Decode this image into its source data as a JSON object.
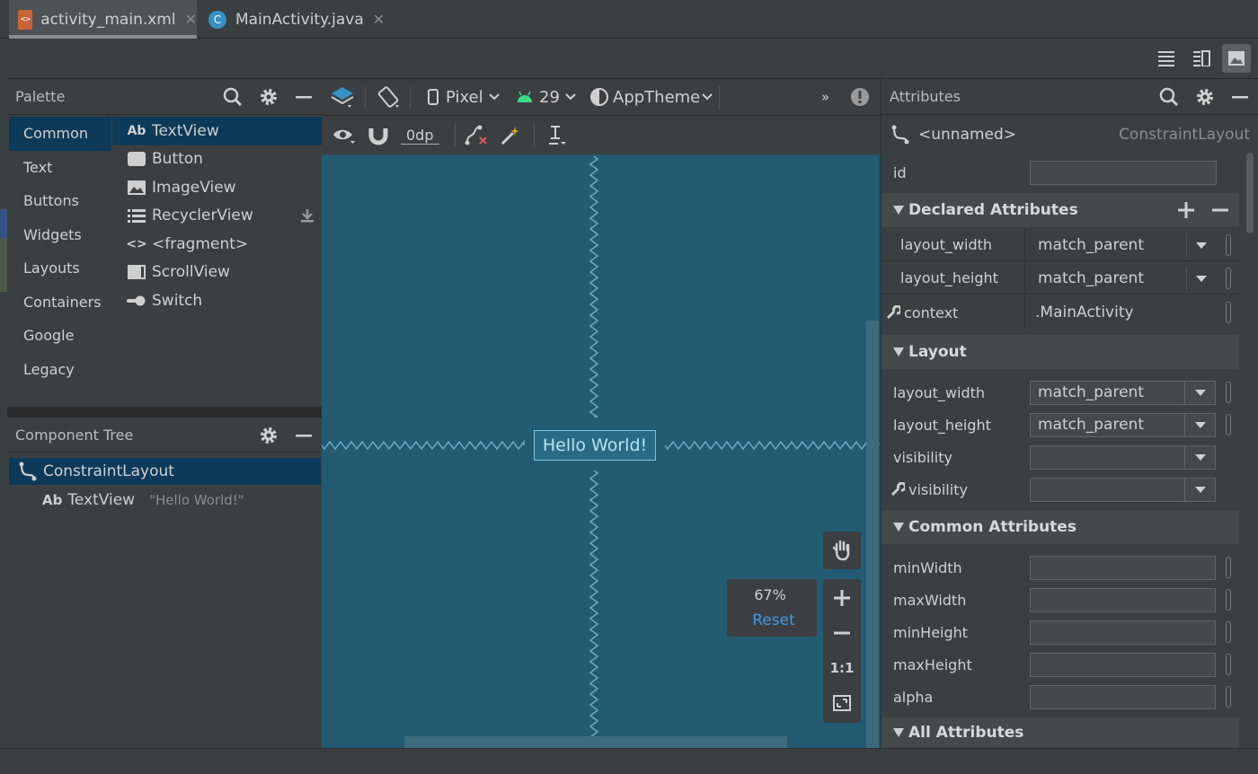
{
  "tabs": [
    {
      "label": "activity_main.xml",
      "close": "✕"
    },
    {
      "label": "MainActivity.java",
      "icon_letter": "C",
      "close": "✕"
    }
  ],
  "palette": {
    "title": "Palette",
    "categories": [
      "Common",
      "Text",
      "Buttons",
      "Widgets",
      "Layouts",
      "Containers",
      "Google",
      "Legacy"
    ],
    "widgets": [
      {
        "label": "TextView",
        "icon": "Ab"
      },
      {
        "label": "Button",
        "icon": "button-icon"
      },
      {
        "label": "ImageView",
        "icon": "image-icon"
      },
      {
        "label": "RecyclerView",
        "icon": "list-icon"
      },
      {
        "label": "<fragment>",
        "icon": "<>"
      },
      {
        "label": "ScrollView",
        "icon": "scroll-icon"
      },
      {
        "label": "Switch",
        "icon": "switch-icon"
      }
    ]
  },
  "component_tree": {
    "title": "Component Tree",
    "root": "ConstraintLayout",
    "child_icon": "Ab",
    "child": "TextView",
    "child_text": "\"Hello World!\""
  },
  "toolbar": {
    "device": "Pixel",
    "api": "29",
    "theme": "AppTheme",
    "margin": "0dp",
    "overflow": "»"
  },
  "canvas": {
    "text": "Hello World!",
    "zoom": "67%",
    "reset": "Reset",
    "one_to_one": "1:1"
  },
  "attributes": {
    "title": "Attributes",
    "component_name": "<unnamed>",
    "component_type": "ConstraintLayout",
    "id_label": "id",
    "declared_title": "Declared Attributes",
    "declared": [
      {
        "label": "layout_width",
        "value": "match_parent"
      },
      {
        "label": "layout_height",
        "value": "match_parent"
      },
      {
        "label": "context",
        "value": ".MainActivity"
      }
    ],
    "layout_title": "Layout",
    "layout": [
      {
        "label": "layout_width",
        "value": "match_parent"
      },
      {
        "label": "layout_height",
        "value": "match_parent"
      },
      {
        "label": "visibility",
        "value": ""
      },
      {
        "label": "visibility",
        "value": ""
      }
    ],
    "common_title": "Common Attributes",
    "common": [
      "minWidth",
      "maxWidth",
      "minHeight",
      "maxHeight",
      "alpha"
    ],
    "all_title": "All Attributes"
  },
  "colors": {
    "accent_link": "#3d9be9",
    "canvas": "#225b72",
    "selection": "#0d3a58",
    "android_green": "#3ddc84"
  }
}
